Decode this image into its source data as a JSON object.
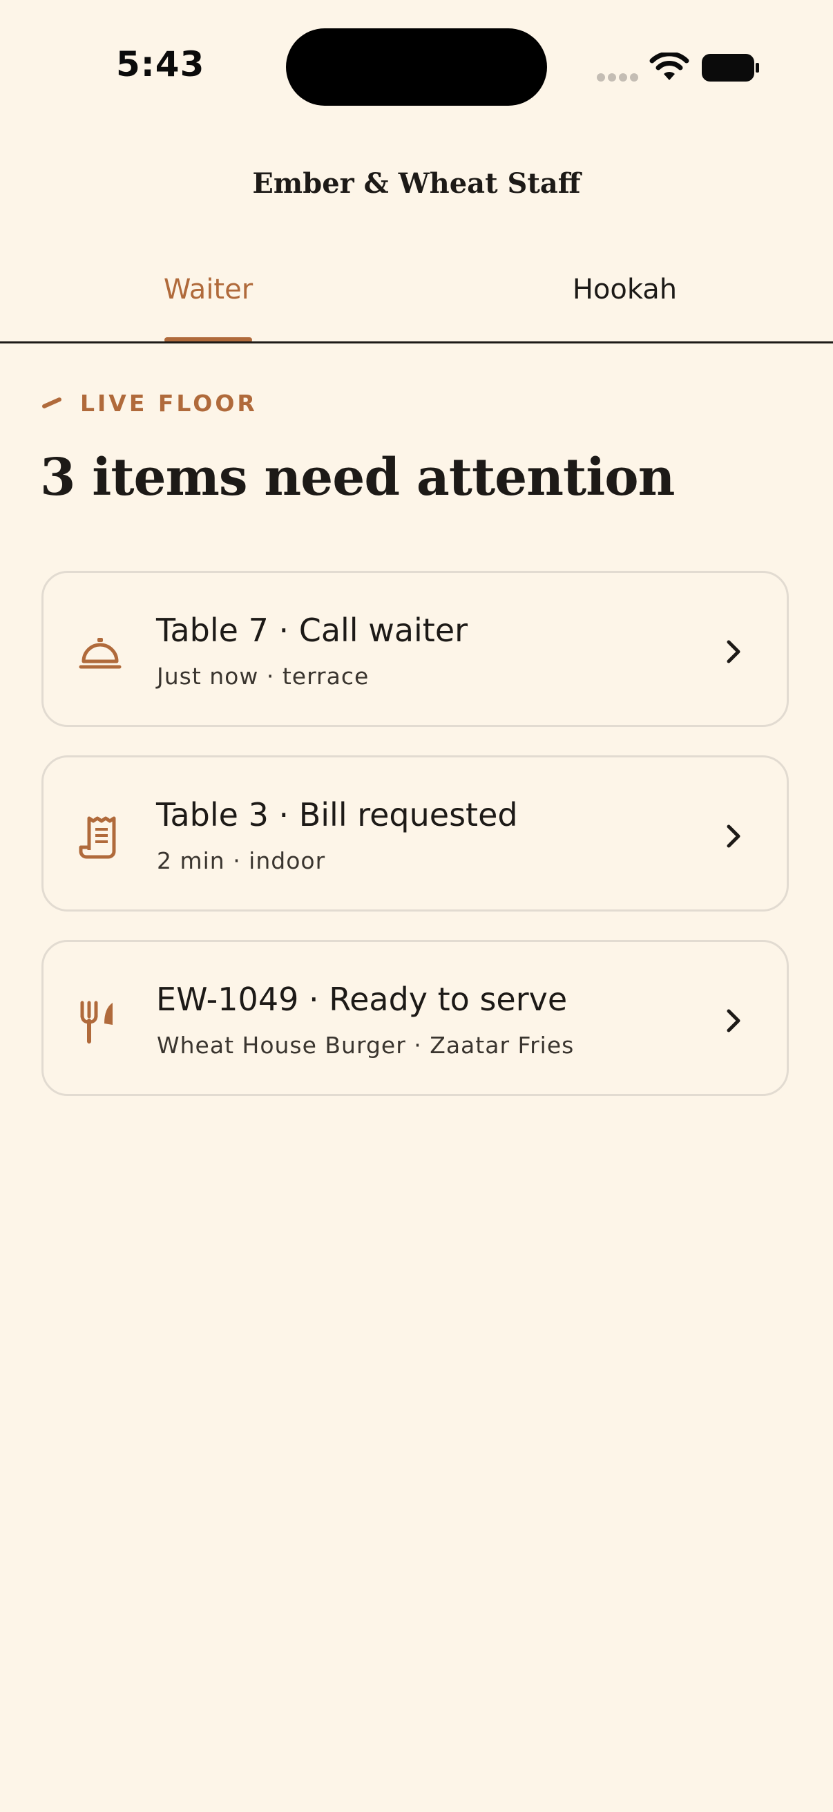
{
  "status_bar": {
    "time": "5:43"
  },
  "app": {
    "title": "Ember & Wheat Staff"
  },
  "tabs": [
    {
      "label": "Waiter",
      "selected": true
    },
    {
      "label": "Hookah",
      "selected": false
    }
  ],
  "section": {
    "eyebrow": "LIVE FLOOR",
    "headline": "3 items need attention"
  },
  "items": [
    {
      "icon": "service-bell-icon",
      "title": "Table 7 · Call waiter",
      "subtitle": "Just now · terrace"
    },
    {
      "icon": "receipt-icon",
      "title": "Table 3 · Bill requested",
      "subtitle": "2 min · indoor"
    },
    {
      "icon": "fork-knife-icon",
      "title": "EW-1049 · Ready to serve",
      "subtitle": "Wheat House Burger · Zaatar Fries"
    }
  ],
  "colors": {
    "background": "#fdf5e8",
    "accent": "#b06a3b",
    "text": "#1d1a17",
    "card_border": "#e2dbd1"
  }
}
